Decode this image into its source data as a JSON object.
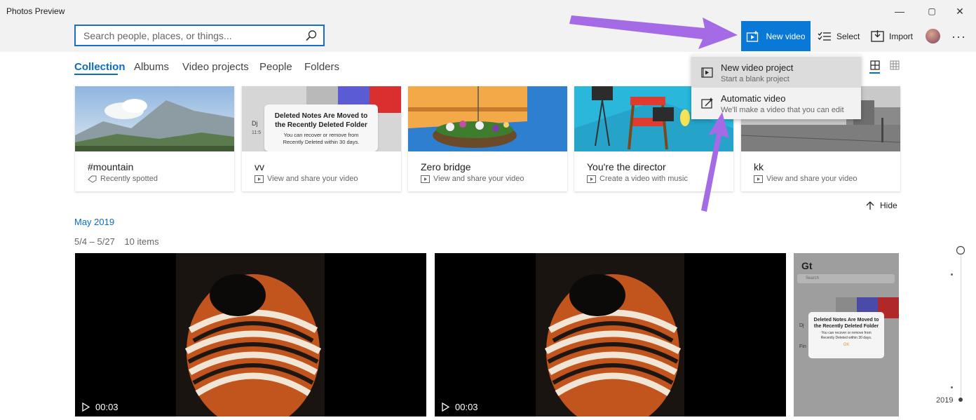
{
  "window": {
    "title": "Photos Preview",
    "minimize_glyph": "—",
    "maximize_glyph": "▢",
    "close_glyph": "✕"
  },
  "search": {
    "placeholder": "Search people, places, or things..."
  },
  "toolbar": {
    "new_video": "New video",
    "select": "Select",
    "import": "Import",
    "more": "···",
    "accent": "#0a78d7"
  },
  "tabs": [
    {
      "label": "Collection",
      "active": true
    },
    {
      "label": "Albums"
    },
    {
      "label": "Video projects"
    },
    {
      "label": "People"
    },
    {
      "label": "Folders"
    }
  ],
  "new_video_menu": [
    {
      "title": "New video project",
      "subtitle": "Start a blank project",
      "icon": "video-project-icon"
    },
    {
      "title": "Automatic video",
      "subtitle": "We'll make a video that you can edit",
      "icon": "magic-video-icon"
    }
  ],
  "cards": [
    {
      "title": "#mountain",
      "subtitle": "Recently spotted",
      "icon": "tag-icon"
    },
    {
      "title": "vv",
      "subtitle": "View and share your video",
      "icon": "video-icon",
      "overlay_title": "Deleted Notes Are Moved to the Recently Deleted Folder",
      "overlay_body": "You can recover or remove from Recently Deleted within 30 days.",
      "overlay_side": "Dj",
      "overlay_side2": "11:5"
    },
    {
      "title": "Zero bridge",
      "subtitle": "View and share your video",
      "icon": "video-icon"
    },
    {
      "title": "You're the director",
      "subtitle": "Create a video with music",
      "icon": "video-icon"
    },
    {
      "title": "kk",
      "subtitle": "View and share your video",
      "icon": "video-icon"
    }
  ],
  "hide_label": "Hide",
  "timeline": {
    "month": "May 2019",
    "range": "5/4 – 5/27",
    "count": "10 items",
    "year": "2019"
  },
  "tiles": [
    {
      "duration": "00:03"
    },
    {
      "duration": "00:03"
    },
    {
      "notes_header": "Gt",
      "search": "Search",
      "notice_title": "Deleted Notes Are Moved to the Recently Deleted Folder",
      "notice_body": "You can recover or remove from Recently Deleted within 30 days.",
      "ok": "OK",
      "side1": "Dj",
      "side2": "Fin"
    }
  ]
}
